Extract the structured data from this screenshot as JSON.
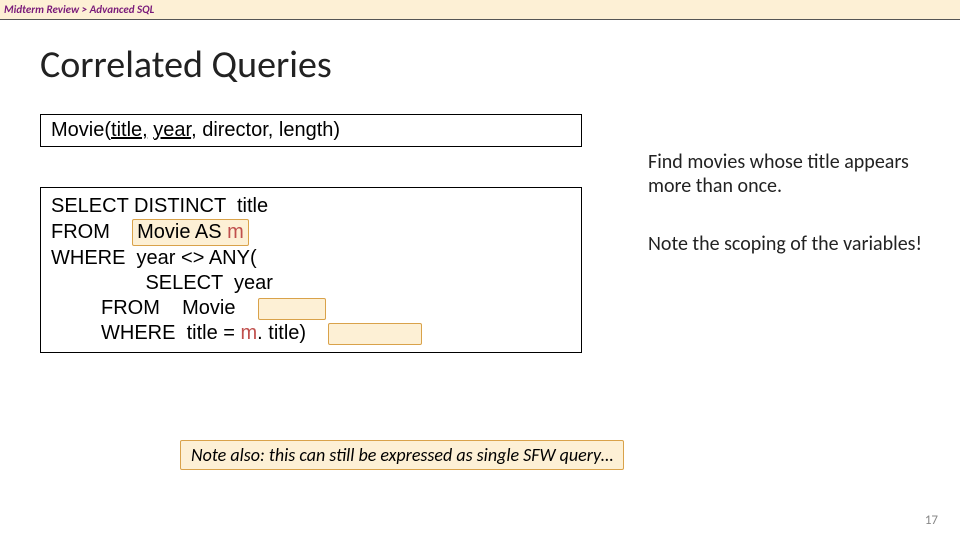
{
  "breadcrumb": {
    "parent": "Midterm Review",
    "sep": "  >  ",
    "child": "Advanced SQL"
  },
  "title": "Correlated Queries",
  "schema": {
    "relation": "Movie(",
    "k1": "title,",
    "sp1": " ",
    "k2": "year",
    "rest": ", director, length)"
  },
  "query": {
    "l1a": "SELECT DISTINCT  title",
    "l2a": "FROM    ",
    "l2box": "Movie AS ",
    "l2m": "m",
    "l3a": "WHERE  year <> ANY(",
    "l4a": "                 SELECT  year",
    "l5a": "         FROM    Movie    ",
    "l6a": "         WHERE  title = ",
    "l6m": "m",
    "l6b": ". title)    "
  },
  "notes": {
    "n1": "Find movies whose title appears more than once.",
    "n2": "Note the scoping of the variables!"
  },
  "footnote": "Note also: this can still be expressed as single SFW query…",
  "page": "17"
}
